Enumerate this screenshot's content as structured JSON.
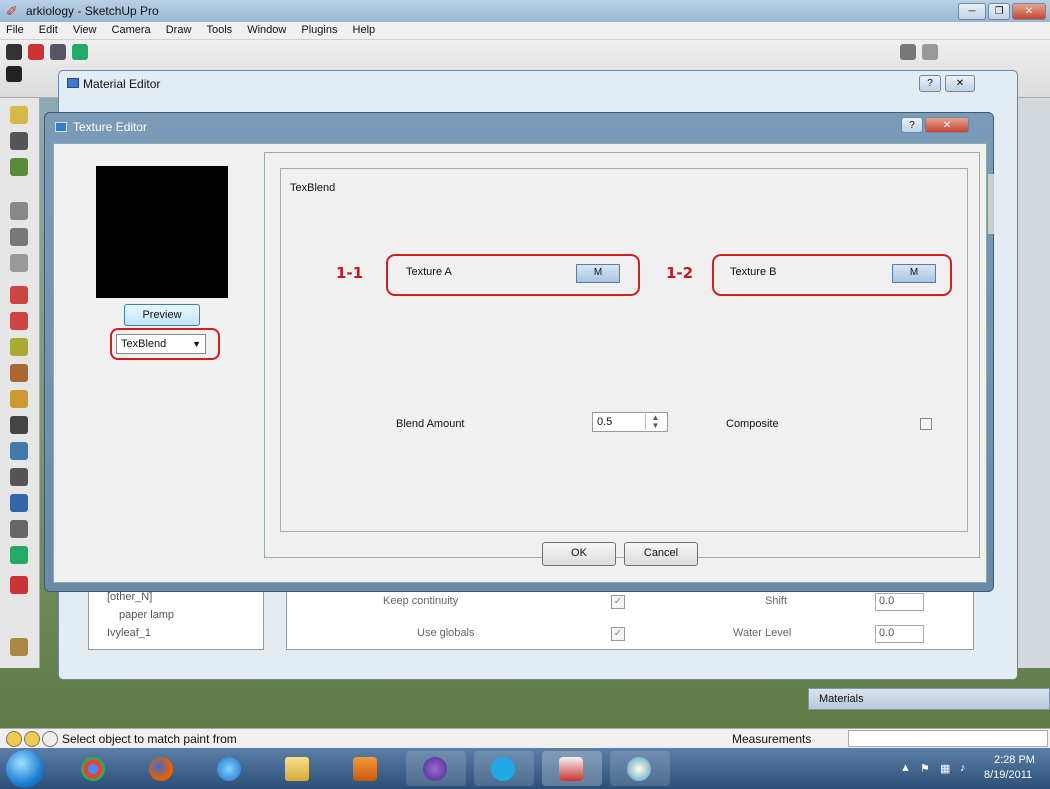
{
  "app": {
    "title": "arkiology - SketchUp Pro"
  },
  "menu": [
    "File",
    "Edit",
    "View",
    "Camera",
    "Draw",
    "Tools",
    "Window",
    "Plugins",
    "Help"
  ],
  "material_editor": {
    "title": "Material Editor"
  },
  "texture_editor": {
    "title": "Texture Editor",
    "preview_button": "Preview",
    "type_select": "TexBlend",
    "group_label": "TexBlend",
    "texture_a_label": "Texture A",
    "texture_a_button": "M",
    "texture_b_label": "Texture B",
    "texture_b_button": "M",
    "blend_amount_label": "Blend Amount",
    "blend_amount_value": "0.5",
    "composite_label": "Composite",
    "ok_button": "OK",
    "cancel_button": "Cancel"
  },
  "annotations": {
    "a1": "1-1",
    "a2": "1-2"
  },
  "background_panel": {
    "tree_items": [
      "[other_N]",
      "paper lamp",
      "Ivyleaf_1"
    ],
    "keep_continuity": "Keep continuity",
    "use_globals": "Use globals",
    "shift_label": "Shift",
    "shift_value": "0.0",
    "water_level_label": "Water Level",
    "water_level_value": "0.0"
  },
  "materials_tray": {
    "label": "Materials"
  },
  "status_bar": {
    "text": "Select object to match paint from",
    "measurements_label": "Measurements"
  },
  "taskbar": {
    "time": "2:28 PM",
    "date": "8/19/2011"
  },
  "colors": {
    "annotation": "#cc1f1f",
    "preview": "#000000"
  }
}
